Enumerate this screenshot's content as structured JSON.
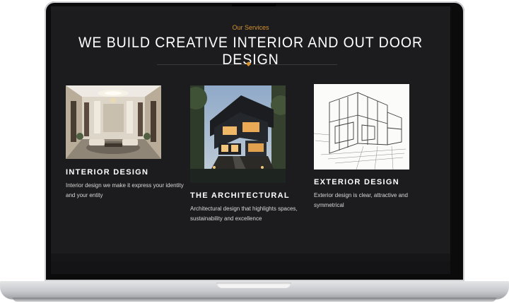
{
  "section": {
    "eyebrow": "Our Services",
    "headline": "WE BUILD CREATIVE INTERIOR AND OUT DOOR DESIGN",
    "accent_color": "#d4922e"
  },
  "services": [
    {
      "title": "INTERIOR DESIGN",
      "description": "Interior design we make it express your identity and your entity",
      "image": "luxury-interior-photo"
    },
    {
      "title": "THE ARCHITECTURAL",
      "description": "Architectural design that highlights spaces, sustainability and excellence",
      "image": "modern-house-night-photo"
    },
    {
      "title": "EXTERIOR DESIGN",
      "description": "Exterior design is clear, attractive and symmetrical",
      "image": "house-sketch-drawing"
    }
  ]
}
